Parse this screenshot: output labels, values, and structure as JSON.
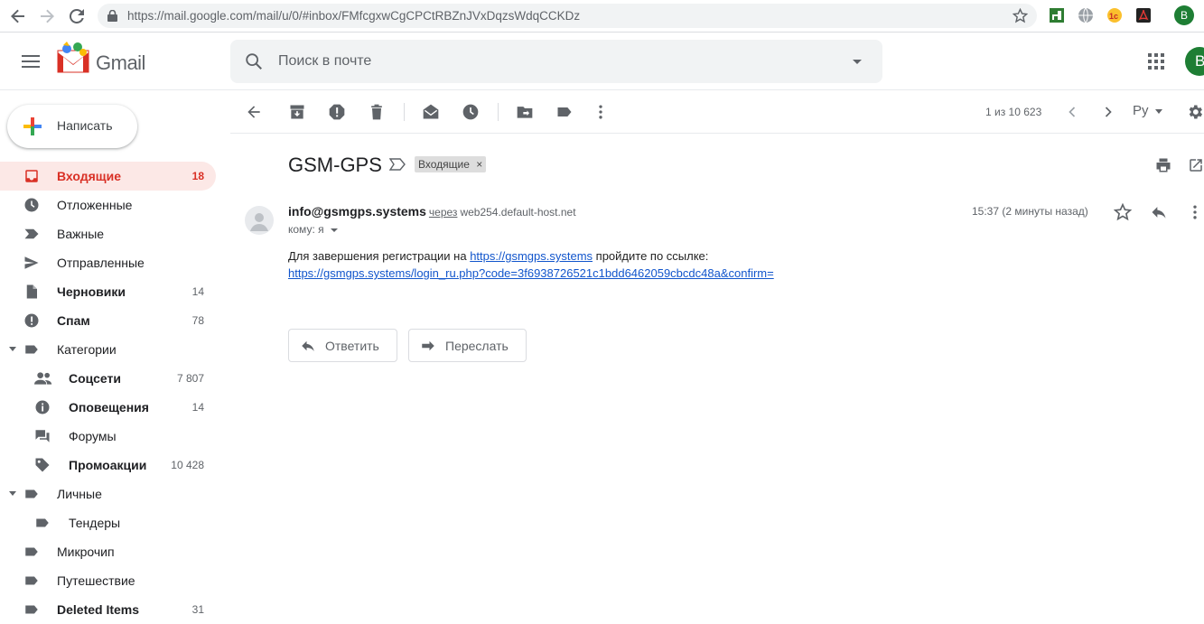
{
  "browser": {
    "url": "https://mail.google.com/mail/u/0/#inbox/FMfcgxwCgCPCtRBZnJVxDqzsWdqCCKDz",
    "profile_letter": "B"
  },
  "app": {
    "logo_text": "Gmail",
    "search_placeholder": "Поиск в почте",
    "account_letter": "B"
  },
  "sidebar": {
    "compose_label": "Написать",
    "items": [
      {
        "label": "Входящие",
        "count": "18",
        "icon": "inbox-icon"
      },
      {
        "label": "Отложенные",
        "count": "",
        "icon": "clock-icon"
      },
      {
        "label": "Важные",
        "count": "",
        "icon": "important-icon"
      },
      {
        "label": "Отправленные",
        "count": "",
        "icon": "send-icon"
      },
      {
        "label": "Черновики",
        "count": "14",
        "icon": "draft-icon"
      },
      {
        "label": "Спам",
        "count": "78",
        "icon": "spam-icon"
      },
      {
        "label": "Категории",
        "count": "",
        "icon": "label-icon"
      },
      {
        "label": "Соцсети",
        "count": "7 807",
        "icon": "people-icon"
      },
      {
        "label": "Оповещения",
        "count": "14",
        "icon": "info-icon"
      },
      {
        "label": "Форумы",
        "count": "",
        "icon": "forum-icon"
      },
      {
        "label": "Промоакции",
        "count": "10 428",
        "icon": "tag-icon"
      },
      {
        "label": "Личные",
        "count": "",
        "icon": "label-icon"
      },
      {
        "label": "Тендеры",
        "count": "",
        "icon": "label-icon"
      },
      {
        "label": "Микрочип",
        "count": "",
        "icon": "label-icon"
      },
      {
        "label": "Путешествие",
        "count": "",
        "icon": "label-icon"
      },
      {
        "label": "Deleted Items",
        "count": "31",
        "icon": "label-icon"
      }
    ]
  },
  "toolbar": {
    "pager": "1 из 10 623",
    "lang": "Ру"
  },
  "message": {
    "subject": "GSM-GPS",
    "label_chip": "Входящие",
    "label_chip_close": "×",
    "sender_email": "info@gsmgps.systems",
    "via": "через",
    "via_host": "web254.default-host.net",
    "to": "кому: я",
    "time": "15:37 (2 минуты назад)",
    "body_prefix": "Для завершения регистрации на",
    "body_link1": "https://gsmgps.systems",
    "body_suffix": "пройдите по ссылке:",
    "body_link2": "https://gsmgps.systems/login_ru.php?code=3f6938726521c1bdd6462059cbcdc48a&confirm=",
    "reply_label": "Ответить",
    "forward_label": "Переслать"
  },
  "colors": {
    "accent_red": "#d93025",
    "active_bg": "#fce8e6",
    "link_blue": "#1155cc",
    "avatar_green": "#1e8e3e"
  }
}
